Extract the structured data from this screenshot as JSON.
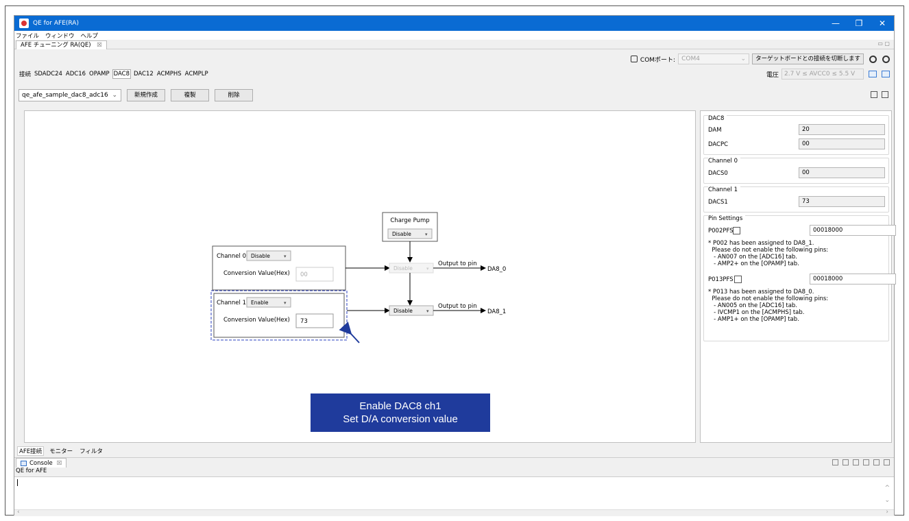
{
  "window": {
    "title": "QE for AFE(RA)",
    "min": "—",
    "restore": "❐",
    "close": "✕"
  },
  "menu": [
    "ファイル",
    "ウィンドウ",
    "ヘルプ"
  ],
  "view_tab": {
    "label": "AFE チューニング RA(QE)",
    "close": "☒"
  },
  "com": {
    "label": "COMポート:",
    "value": "COM4",
    "disconnect_label": "ターゲットボードとの接続を切断します"
  },
  "tabs": [
    "接続",
    "SDADC24",
    "ADC16",
    "OPAMP",
    "DAC8",
    "DAC12",
    "ACMPHS",
    "ACMPLP"
  ],
  "active_tab": "DAC8",
  "voltage": {
    "label": "電圧",
    "value": "2.7 V ≤ AVCC0 ≤ 5.5 V"
  },
  "sample": {
    "value": "qe_afe_sample_dac8_adc16",
    "new_label": "新規作成",
    "copy_label": "複製",
    "delete_label": "削除"
  },
  "diagram": {
    "charge_pump": {
      "title": "Charge Pump",
      "value": "Disable"
    },
    "ch0": {
      "label": "Channel 0",
      "mode": "Disable",
      "conv_label": "Conversion Value(Hex)",
      "conv_value": "00",
      "mux": "Disable",
      "output_label": "Output to pin",
      "pin": "DA8_0"
    },
    "ch1": {
      "label": "Channel 1",
      "mode": "Enable",
      "conv_label": "Conversion Value(Hex)",
      "conv_value": "73",
      "mux": "Disable",
      "output_label": "Output to pin",
      "pin": "DA8_1"
    }
  },
  "callout": {
    "line1": "Enable DAC8 ch1",
    "line2": "Set D/A conversion value"
  },
  "panel": {
    "dac8": {
      "title": "DAC8",
      "dam_label": "DAM",
      "dam": "20",
      "dacpc_label": "DACPC",
      "dacpc": "00"
    },
    "channel0": {
      "title": "Channel 0",
      "dacs0_label": "DACS0",
      "dacs0": "00"
    },
    "channel1": {
      "title": "Channel 1",
      "dacs1_label": "DACS1",
      "dacs1": "73"
    },
    "pin": {
      "title": "Pin Settings",
      "p002_label": "P002PFS",
      "p002": "00018000",
      "p002_note": "* P002 has been assigned to DA8_1.\n  Please do not enable the following pins:\n   - AN007 on the [ADC16] tab.\n   - AMP2+ on the [OPAMP] tab.",
      "p013_label": "P013PFS",
      "p013": "00018000",
      "p013_note": "* P013 has been assigned to DA8_0.\n  Please do not enable the following pins:\n   - AN005 on the [ADC16] tab.\n   - IVCMP1 on the [ACMPHS] tab.\n   - AMP1+ on the [OPAMP] tab."
    }
  },
  "bottom_tabs": [
    "AFE接続",
    "モニター",
    "フィルタ"
  ],
  "console": {
    "tab_label": "Console",
    "close": "☒",
    "name": "QE for AFE"
  },
  "colors": {
    "titlebar": "#0a6bd3",
    "callout": "#1f3b9c",
    "dashed_border": "#2a3fbf"
  }
}
